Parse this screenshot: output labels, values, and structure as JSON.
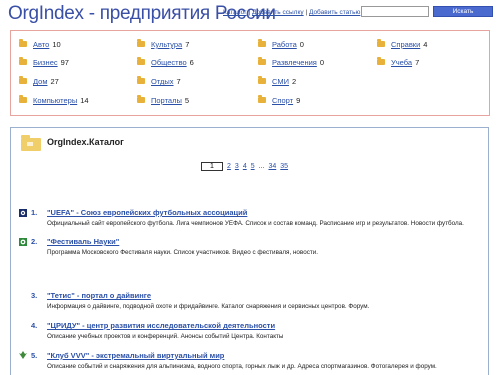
{
  "header": {
    "title": "OrgIndex - предприятия России",
    "links": [
      "Каталог",
      "Добавить ссылку",
      "Добавить статью"
    ],
    "separator": "|",
    "search_placeholder": "",
    "search_button": "Искать"
  },
  "categories": [
    {
      "label": "Авто",
      "count": "10"
    },
    {
      "label": "Бизнес",
      "count": "97"
    },
    {
      "label": "Дом",
      "count": "27"
    },
    {
      "label": "Компьютеры",
      "count": "14"
    },
    {
      "label": "Культура",
      "count": "7"
    },
    {
      "label": "Общество",
      "count": "6"
    },
    {
      "label": "Отдых",
      "count": "7"
    },
    {
      "label": "Порталы",
      "count": "5"
    },
    {
      "label": "Работа",
      "count": "0"
    },
    {
      "label": "Развлечения",
      "count": "0"
    },
    {
      "label": "СМИ",
      "count": "2"
    },
    {
      "label": "Спорт",
      "count": "9"
    },
    {
      "label": "Справки",
      "count": "4"
    },
    {
      "label": "Учеба",
      "count": "7"
    }
  ],
  "main": {
    "title": "OrgIndex.Каталог",
    "pager": {
      "current": "1",
      "pages": [
        "2",
        "3",
        "4",
        "5"
      ],
      "dots": "...",
      "tail": [
        "34",
        "35"
      ]
    },
    "entries": [
      {
        "num": "1.",
        "title": "\"UEFA\" - Союз европейских футбольных ассоциаций",
        "desc": "Официальный сайт европейского футбола. Лига чемпионов УЕФА. Список и состав команд. Расписание игр и результатов. Новости футбола.",
        "icon": "uefa-icon"
      },
      {
        "num": "2.",
        "title": "\"Фестиваль Науки\"",
        "desc": "Программа Московского Фестиваля науки. Список участников. Видео с фестиваля, новости.",
        "icon": "science-festival-icon"
      },
      {
        "num": "3.",
        "title": "\"Тетис\" - портал о дайвинге",
        "desc": "Информация о дайвинге, подводной охоте и фридайвинге. Каталог снаряжения и сервисных центров. Форум.",
        "icon": ""
      },
      {
        "num": "4.",
        "title": "\"ЦРИДУ\" - центр развития исследовательской деятельности",
        "desc": "Описание учебных проектов и конференций. Анонсы событий Центра. Контакты",
        "icon": ""
      },
      {
        "num": "5.",
        "title": "\"Клуб VVV\" - экстремальный виртуальный мир",
        "desc": "Описание событий и снаряжения для альпинизма, водного спорта, горных лыж и др. Адреса спортмагазинов. Фотогалерея и форум.",
        "icon": "club-vvv-icon"
      }
    ]
  },
  "colors": {
    "accent": "#2b50a8",
    "title": "#3a4fa6",
    "folder": "#e7b13a",
    "cat_border": "#e7a49e",
    "main_border": "#9bb0cf",
    "button": "#4a6ad0"
  }
}
